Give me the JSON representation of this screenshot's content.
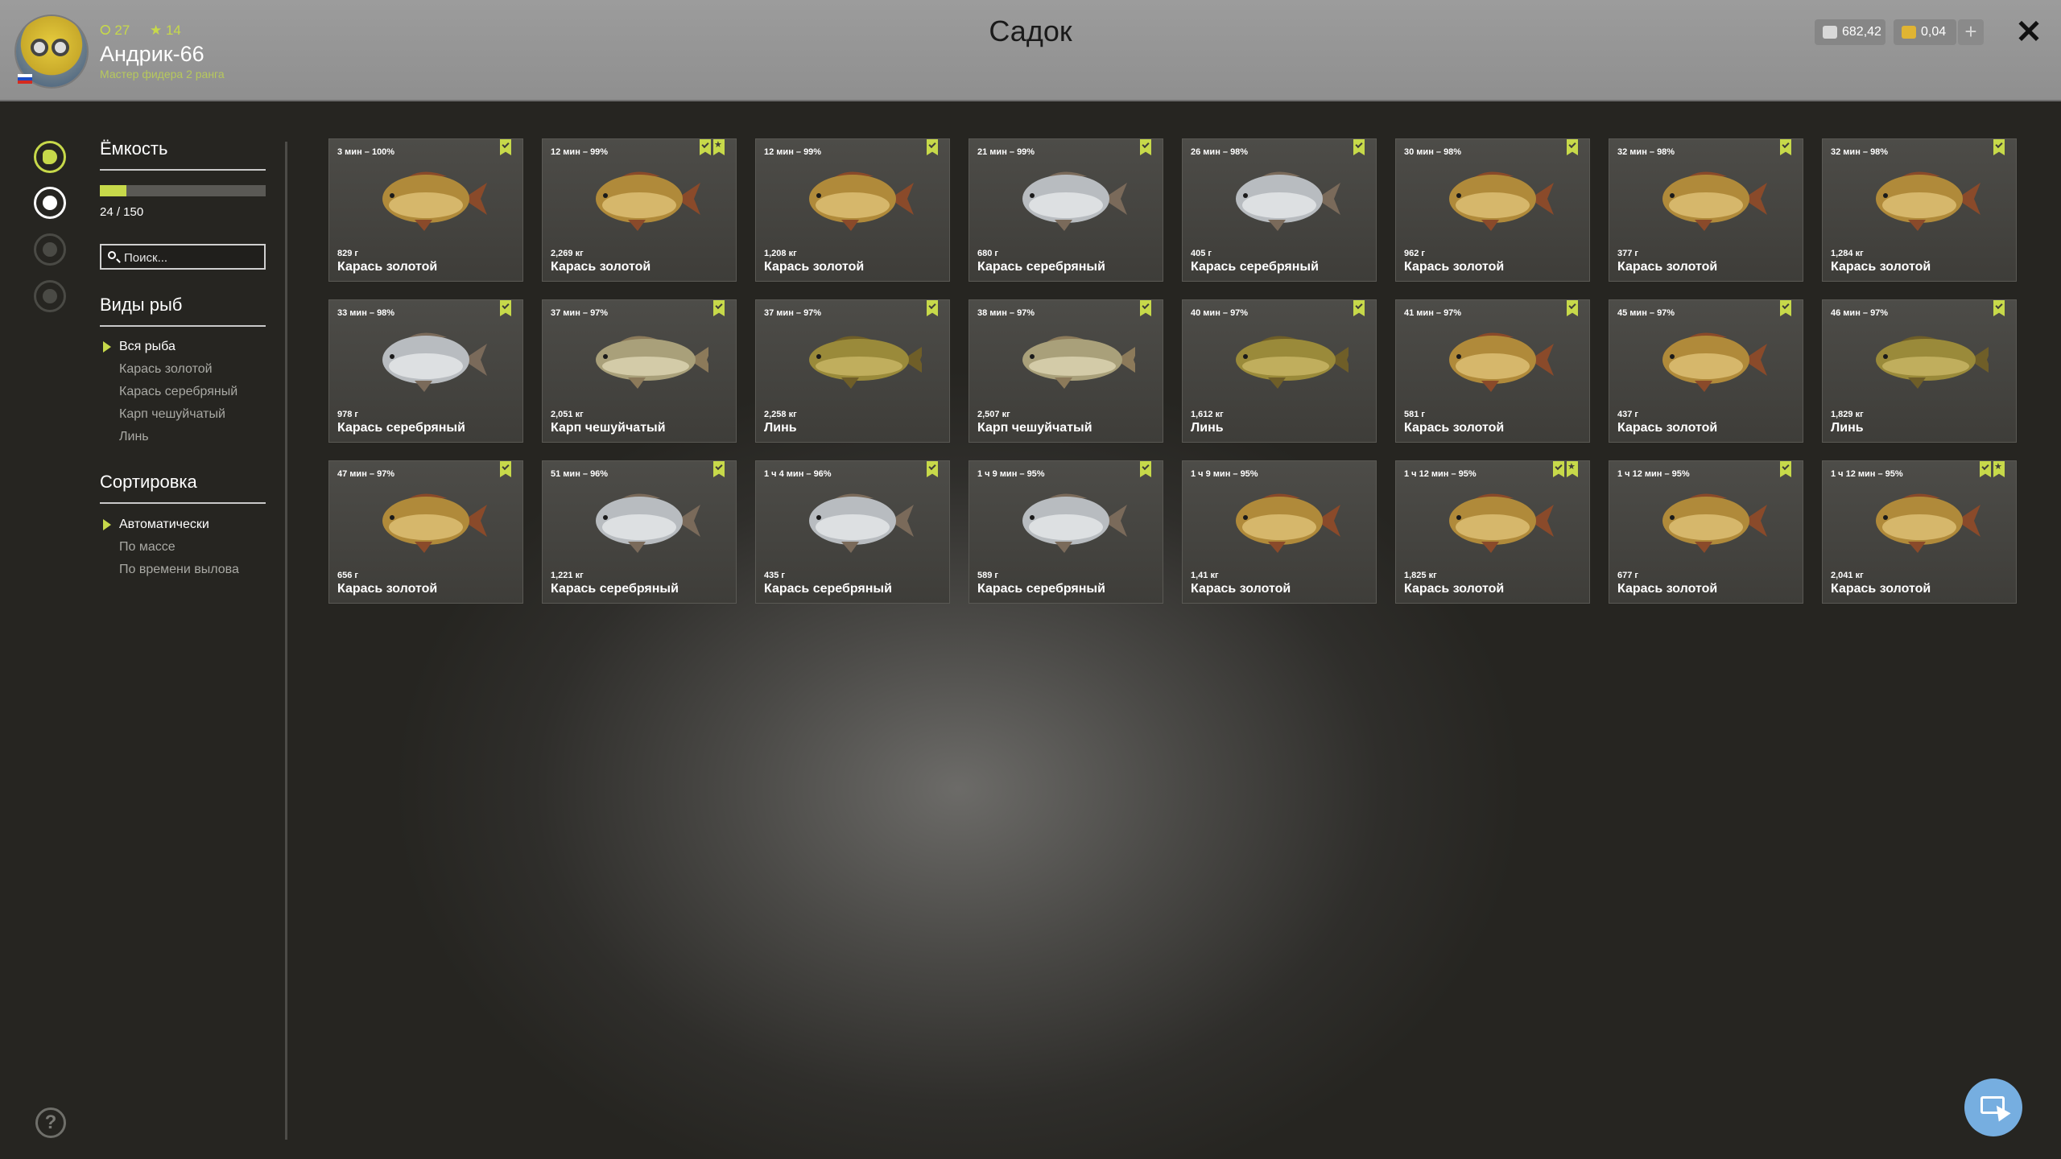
{
  "window": {
    "title": "Садок"
  },
  "profile": {
    "stat_level": "27",
    "stat_stars": "14",
    "username": "Андрик-66",
    "rank": "Мастер фидера 2 ранга"
  },
  "currency": {
    "silver": "682,42",
    "gold": "0,04"
  },
  "left": {
    "capacity_title": "Ёмкость",
    "capacity_count": "24 / 150",
    "capacity_fraction": 0.16,
    "search_placeholder": "Поиск...",
    "species_title": "Виды рыб",
    "species": [
      "Вся рыба",
      "Карась золотой",
      "Карась серебряный",
      "Карп чешуйчатый",
      "Линь"
    ],
    "sort_title": "Сортировка",
    "sort_options": [
      "Автоматически",
      "По массе",
      "По времени вылова"
    ]
  },
  "colors": {
    "accent": "#c7d94a",
    "fab": "#76aee0"
  },
  "icons": [
    "fish-tab-icon",
    "keepnet-tab-icon",
    "trophy-tab-icon",
    "medal-tab-icon",
    "help-icon",
    "close-icon",
    "silver-coin-icon",
    "gold-coin-icon",
    "plus-icon",
    "cursor-screen-icon"
  ],
  "fish": [
    {
      "meta": "3 мин – 100%",
      "weight": "829 г",
      "name": "Карась золотой",
      "kind": "gold",
      "marks": [
        "check"
      ]
    },
    {
      "meta": "12 мин – 99%",
      "weight": "2,269 кг",
      "name": "Карась золотой",
      "kind": "gold",
      "marks": [
        "check",
        "star"
      ]
    },
    {
      "meta": "12 мин – 99%",
      "weight": "1,208 кг",
      "name": "Карась золотой",
      "kind": "gold",
      "marks": [
        "check"
      ]
    },
    {
      "meta": "21 мин – 99%",
      "weight": "680 г",
      "name": "Карась серебряный",
      "kind": "silver",
      "marks": [
        "check"
      ]
    },
    {
      "meta": "26 мин – 98%",
      "weight": "405 г",
      "name": "Карась серебряный",
      "kind": "silver",
      "marks": [
        "check"
      ]
    },
    {
      "meta": "30 мин – 98%",
      "weight": "962 г",
      "name": "Карась золотой",
      "kind": "gold",
      "marks": [
        "check"
      ]
    },
    {
      "meta": "32 мин – 98%",
      "weight": "377 г",
      "name": "Карась золотой",
      "kind": "gold",
      "marks": [
        "check"
      ]
    },
    {
      "meta": "32 мин – 98%",
      "weight": "1,284 кг",
      "name": "Карась золотой",
      "kind": "gold",
      "marks": [
        "check"
      ]
    },
    {
      "meta": "33 мин – 98%",
      "weight": "978 г",
      "name": "Карась серебряный",
      "kind": "silver",
      "marks": [
        "check"
      ]
    },
    {
      "meta": "37 мин – 97%",
      "weight": "2,051 кг",
      "name": "Карп чешуйчатый",
      "kind": "carp",
      "marks": [
        "check"
      ]
    },
    {
      "meta": "37 мин – 97%",
      "weight": "2,258 кг",
      "name": "Линь",
      "kind": "tench",
      "marks": [
        "check"
      ]
    },
    {
      "meta": "38 мин – 97%",
      "weight": "2,507 кг",
      "name": "Карп чешуйчатый",
      "kind": "carp",
      "marks": [
        "check"
      ]
    },
    {
      "meta": "40 мин – 97%",
      "weight": "1,612 кг",
      "name": "Линь",
      "kind": "tench",
      "marks": [
        "check"
      ]
    },
    {
      "meta": "41 мин – 97%",
      "weight": "581 г",
      "name": "Карась золотой",
      "kind": "gold",
      "marks": [
        "check"
      ]
    },
    {
      "meta": "45 мин – 97%",
      "weight": "437 г",
      "name": "Карась золотой",
      "kind": "gold",
      "marks": [
        "check"
      ]
    },
    {
      "meta": "46 мин – 97%",
      "weight": "1,829 кг",
      "name": "Линь",
      "kind": "tench",
      "marks": [
        "check"
      ]
    },
    {
      "meta": "47 мин – 97%",
      "weight": "656 г",
      "name": "Карась золотой",
      "kind": "gold",
      "marks": [
        "check"
      ]
    },
    {
      "meta": "51 мин – 96%",
      "weight": "1,221 кг",
      "name": "Карась серебряный",
      "kind": "silver",
      "marks": [
        "check"
      ]
    },
    {
      "meta": "1 ч 4 мин – 96%",
      "weight": "435 г",
      "name": "Карась серебряный",
      "kind": "silver",
      "marks": [
        "check"
      ]
    },
    {
      "meta": "1 ч 9 мин – 95%",
      "weight": "589 г",
      "name": "Карась серебряный",
      "kind": "silver",
      "marks": [
        "check"
      ]
    },
    {
      "meta": "1 ч 9 мин – 95%",
      "weight": "1,41 кг",
      "name": "Карась золотой",
      "kind": "gold",
      "marks": []
    },
    {
      "meta": "1 ч 12 мин – 95%",
      "weight": "1,825 кг",
      "name": "Карась золотой",
      "kind": "gold",
      "marks": [
        "check",
        "star"
      ]
    },
    {
      "meta": "1 ч 12 мин – 95%",
      "weight": "677 г",
      "name": "Карась золотой",
      "kind": "gold",
      "marks": [
        "check"
      ]
    },
    {
      "meta": "1 ч 12 мин – 95%",
      "weight": "2,041 кг",
      "name": "Карась золотой",
      "kind": "gold",
      "marks": [
        "check",
        "star"
      ]
    }
  ]
}
